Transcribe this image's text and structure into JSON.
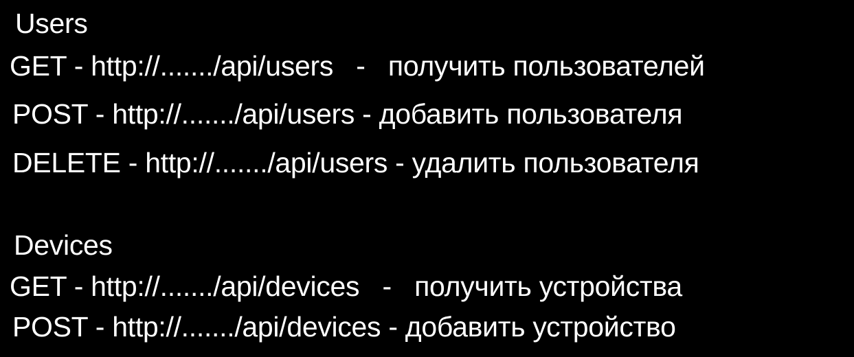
{
  "sections": {
    "users": {
      "heading": "Users",
      "lines": [
        "GET - http://......./api/users   -   получить пользователей",
        "POST - http://......./api/users - добавить пользователя",
        "DELETE - http://......./api/users - удалить пользователя"
      ]
    },
    "devices": {
      "heading": "Devices",
      "lines": [
        "GET - http://......./api/devices   -   получить устройства",
        "POST - http://......./api/devices - добавить устройство"
      ]
    }
  },
  "colors": {
    "background": "#000000",
    "text": "#ffffff"
  }
}
